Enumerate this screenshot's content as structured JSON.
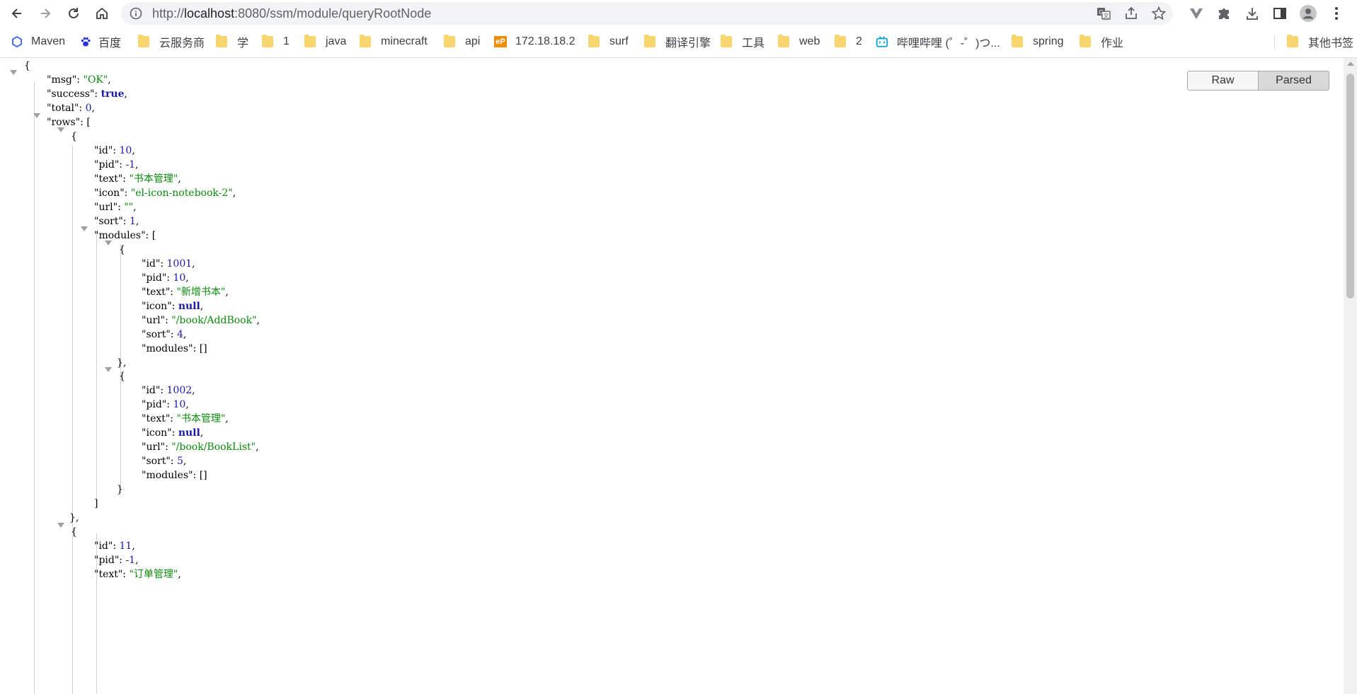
{
  "browser": {
    "url_prefix": "http://",
    "url_host": "localhost",
    "url_rest": ":8080/ssm/module/queryRootNode"
  },
  "bookmarks": {
    "items": [
      "Maven",
      "百度",
      "云服务商",
      "学",
      "1",
      "java",
      "minecraft",
      "api",
      "172.18.18.2",
      "surf",
      "翻译引擎",
      "工具",
      "web",
      "2",
      "哔哩哔哩 (゜-゜)つ...",
      "spring",
      "作业"
    ],
    "other": "其他书签",
    "ep_badge": "eP"
  },
  "viewer": {
    "raw_label": "Raw",
    "parsed_label": "Parsed"
  },
  "json": {
    "open_brace": "{",
    "close_brace": "}",
    "close_brace_comma": "},",
    "open_bracket": "[",
    "close_bracket": "]",
    "empty_array": "[]",
    "k_msg": "\"msg\": ",
    "v_msg": "\"OK\"",
    "k_success": "\"success\": ",
    "v_success": "true",
    "k_total": "\"total\": ",
    "v_total": "0",
    "k_rows": "\"rows\": ",
    "k_id": "\"id\": ",
    "k_pid": "\"pid\": ",
    "k_text": "\"text\": ",
    "k_icon": "\"icon\": ",
    "k_url": "\"url\": ",
    "k_sort": "\"sort\": ",
    "k_modules": "\"modules\": ",
    "comma": ",",
    "row0": {
      "id": "10",
      "pid": "-1",
      "text": "\"书本管理\"",
      "icon": "\"el-icon-notebook-2\"",
      "url": "\"\"",
      "sort": "1"
    },
    "m0": {
      "id": "1001",
      "pid": "10",
      "text": "\"新增书本\"",
      "icon": "null",
      "url": "\"/book/AddBook\"",
      "sort": "4"
    },
    "m1": {
      "id": "1002",
      "pid": "10",
      "text": "\"书本管理\"",
      "icon": "null",
      "url": "\"/book/BookList\"",
      "sort": "5"
    },
    "row1": {
      "id": "11",
      "pid": "-1",
      "text": "\"订单管理\""
    }
  }
}
